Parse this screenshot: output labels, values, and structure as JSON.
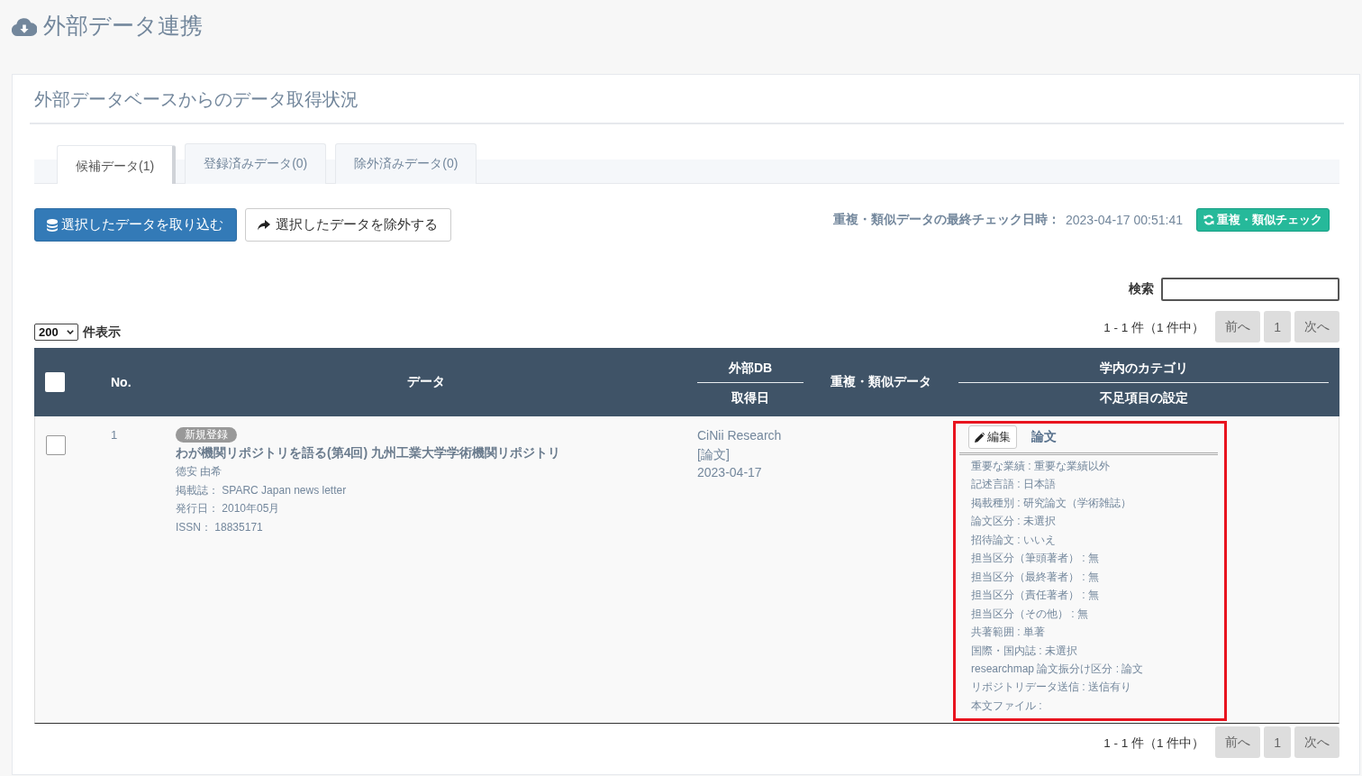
{
  "page": {
    "title": "外部データ連携"
  },
  "panel": {
    "title": "外部データベースからのデータ取得状況"
  },
  "tabs": [
    {
      "label": "候補データ(1)",
      "selected": true
    },
    {
      "label": "登録済みデータ(0)",
      "selected": false
    },
    {
      "label": "除外済みデータ(0)",
      "selected": false
    }
  ],
  "actions": {
    "import_button": "選択したデータを取り込む",
    "exclude_button": "選択したデータを除外する",
    "last_check_label": "重複・類似データの最終チェック日時：",
    "last_check_value": "2023-04-17 00:51:41",
    "check_button": "重複・類似チェック"
  },
  "search": {
    "label": "検索"
  },
  "page_size": {
    "value": "200",
    "suffix": "件表示"
  },
  "pagination_top": {
    "summary": "1 - 1 件（1 件中）",
    "buttons": [
      "前へ",
      "1",
      "次へ"
    ]
  },
  "table": {
    "columns": [
      {
        "kind": "checkbox",
        "checked": false
      },
      {
        "kind": "text",
        "label": "No."
      },
      {
        "kind": "text",
        "label": "データ"
      },
      {
        "kind": "stacked",
        "labels": [
          "外部DB",
          "取得日"
        ]
      },
      {
        "kind": "text",
        "label": "重複・類似データ"
      },
      {
        "kind": "stacked",
        "labels": [
          "学内のカテゴリ",
          "不足項目の設定"
        ]
      }
    ],
    "rows": [
      {
        "checked": false,
        "no": "1",
        "badge": "新規登録",
        "title": "わが機関リポジトリを語る(第4回) 九州工業大学学術機関リポジトリ",
        "author": "徳安 由希",
        "details": [
          "掲載誌： SPARC Japan news letter",
          "発行日： 2010年05月",
          "ISSN： 18835171"
        ],
        "source": [
          "CiNii Research",
          "[論文]",
          "2023-04-17"
        ],
        "category": {
          "highlighted": true,
          "edit_button": "編集",
          "name": "論文",
          "fields": [
            "重要な業績 : 重要な業績以外",
            "記述言語 : 日本語",
            "掲載種別 : 研究論文（学術雑誌）",
            "論文区分 : 未選択",
            "招待論文 : いいえ",
            "担当区分（筆頭著者） : 無",
            "担当区分（最終著者） : 無",
            "担当区分（責任著者） : 無",
            "担当区分（その他） : 無",
            "共著範囲 : 単著",
            "国際・国内誌 : 未選択",
            "researchmap 論文振分け区分 : 論文",
            "リポジトリデータ送信 : 送信有り",
            "本文ファイル :"
          ]
        }
      }
    ]
  },
  "pagination_bottom": {
    "summary": "1 - 1 件（1 件中）",
    "buttons": [
      "前へ",
      "1",
      "次へ"
    ]
  }
}
